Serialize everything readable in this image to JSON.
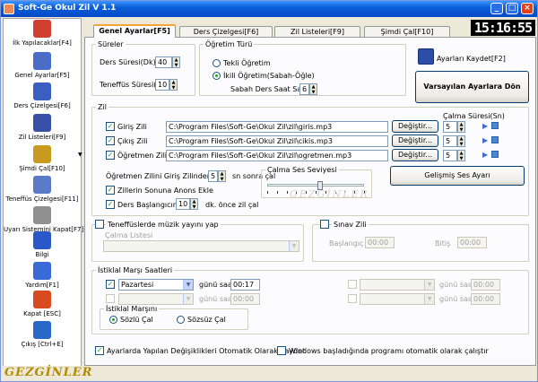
{
  "window": {
    "title": "Soft-Ge Okul Zil V 1.1"
  },
  "clock": "15:16:55",
  "sidebar": {
    "items": [
      {
        "label": "İlk Yapılacaklar[F4]",
        "icon": "checklist-icon",
        "color": "#d04030"
      },
      {
        "label": "Genel Ayarlar[F5]",
        "icon": "tools-icon",
        "color": "#4a6ec8"
      },
      {
        "label": "Ders Çizelgesi[F6]",
        "icon": "calendar-icon",
        "color": "#3a5fc0"
      },
      {
        "label": "Zil Listeleri[F9]",
        "icon": "notebook-icon",
        "color": "#3850a8"
      },
      {
        "label": "Şimdi Çal[F10]",
        "icon": "bell-icon",
        "color": "#c89a20"
      },
      {
        "label": "Teneffüs Çizelgesi[F11]",
        "icon": "schedule-icon",
        "color": "#5a7ac8"
      },
      {
        "label": "Uyarı Sistemini Kapat[F7]",
        "icon": "clock-icon",
        "color": "#909090"
      },
      {
        "label": "Bilgi",
        "icon": "info-icon",
        "color": "#2a58c8"
      },
      {
        "label": "Yardım[F1]",
        "icon": "help-icon",
        "color": "#3a6ad8"
      },
      {
        "label": "Kapat [ESC]",
        "icon": "power-icon",
        "color": "#d84a20"
      },
      {
        "label": "Çıkış [Ctrl+E]",
        "icon": "exit-icon",
        "color": "#2a68c8"
      }
    ]
  },
  "tabs": [
    "Genel Ayarlar[F5]",
    "Ders Çizelgesi[F6]",
    "Zil Listeleri[F9]",
    "Şimdi Çal[F10]"
  ],
  "sureler": {
    "legend": "Süreler",
    "ders_label": "Ders Süresi(Dk)",
    "ders_value": "40",
    "teneffus_label": "Teneffüs Süresi(Dk)",
    "teneffus_value": "10"
  },
  "ogretim": {
    "legend": "Öğretim Türü",
    "tekli": "Tekli Öğretim",
    "ikili": "İkili Öğretim(Sabah-Öğle)",
    "sabah_label": "Sabah Ders Saat Sayısı",
    "sabah_value": "6"
  },
  "buttons": {
    "save": "Ayarları Kaydet[F2]",
    "defaults": "Varsayılan Ayarlara Dön",
    "change": "Değiştir...",
    "advanced_sound": "Gelişmiş Ses Ayarı"
  },
  "zil": {
    "legend": "Zil",
    "calma_suresi_header": "Çalma Süresi(Sn)",
    "rows": [
      {
        "label": "Giriş Zili",
        "path": "C:\\Program Files\\Soft-Ge\\Okul Zil\\zil\\giris.mp3",
        "seconds": "5"
      },
      {
        "label": "Çıkış Zili",
        "path": "C:\\Program Files\\Soft-Ge\\Okul Zil\\zil\\cikis.mp3",
        "seconds": "5"
      },
      {
        "label": "Öğretmen Zili",
        "path": "C:\\Program Files\\Soft-Ge\\Okul Zil\\zil\\ogretmen.mp3",
        "seconds": "5"
      }
    ],
    "ogretmen_prefix": "Öğretmen Zilini Giriş Zilinden",
    "ogretmen_value": "5",
    "ogretmen_suffix": "sn sonra çal",
    "anons": "Zillerin Sonuna Anons Ekle",
    "ders_bas_label": "Ders Başlangıcından",
    "ders_bas_value": "10",
    "ders_bas_suffix": "dk. önce zil çal",
    "volume_label": "Çalma Ses Seviyesi",
    "volume_level": 0.55
  },
  "teneffus_muzik": {
    "label": "Teneffüslerde müzik yayını yap",
    "list_label": "Çalma Listesi"
  },
  "sinav": {
    "label": "Sınav Zili",
    "start_label": "Başlangıç",
    "start_value": "00:00",
    "end_label": "Bitiş",
    "end_value": "00:00"
  },
  "istiklal": {
    "legend": "İstiklal Marşı Saatleri",
    "day": "Pazartesi",
    "gunu_saat": "günü saat",
    "time1": "00:17",
    "time_empty": "00:00",
    "marsi_legend": "İstiklal Marşını",
    "sozlu": "Sözlü Çal",
    "sozsuz": "Sözsüz Çal"
  },
  "footer": {
    "auto_save": "Ayarlarda Yapılan Değişiklikleri Otomatik Olarak Kaydet",
    "auto_start": "Windows başladığında programı otomatik olarak çalıştır"
  },
  "watermark": "GEZGİNLER"
}
